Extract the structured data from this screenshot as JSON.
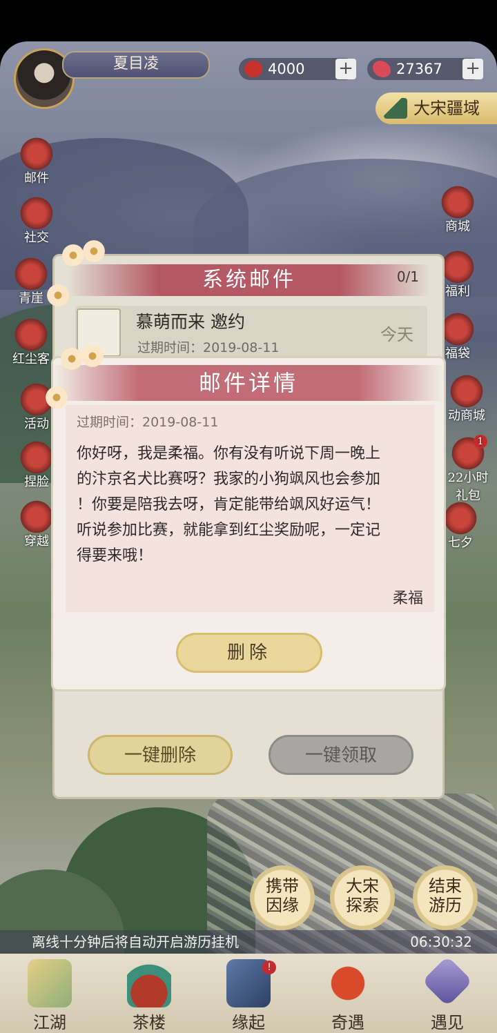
{
  "player": {
    "name": "夏目凌"
  },
  "resources": [
    {
      "icon": "red-bean-icon",
      "value": "4000",
      "plus": "+"
    },
    {
      "icon": "butterfly-icon",
      "value": "27367",
      "plus": "+"
    }
  ],
  "region": {
    "label": "大宋疆域"
  },
  "left_menu": [
    {
      "id": "mail",
      "label": "邮件"
    },
    {
      "id": "social",
      "label": "社交"
    },
    {
      "id": "qingya",
      "label": "青崖"
    },
    {
      "id": "hongchenke",
      "label": "红尘客"
    },
    {
      "id": "events",
      "label": "活动"
    },
    {
      "id": "face",
      "label": "捏脸"
    },
    {
      "id": "travel",
      "label": "穿越"
    }
  ],
  "right_menu": [
    {
      "id": "shop",
      "label": "商城"
    },
    {
      "id": "welfare",
      "label": "福利"
    },
    {
      "id": "lucky-bag",
      "label": "福袋"
    },
    {
      "id": "event-shop",
      "label": "动商城"
    },
    {
      "id": "gift-pack",
      "label": "22小时",
      "sub": "礼包",
      "badge": "1"
    },
    {
      "id": "qixi",
      "label": "七夕"
    }
  ],
  "mail_panel": {
    "title": "系统邮件",
    "count": "0/1",
    "mail": {
      "title": "慕萌而来 邀约",
      "expiry": "过期时间：2019-08-11",
      "date": "今天"
    },
    "delete_all": "一键删除",
    "claim_all": "一键领取"
  },
  "detail": {
    "title": "邮件详情",
    "expiry": "过期时间：2019-08-11",
    "lines": [
      "你好呀，我是柔福。你有没有听说下周一晚上",
      "的汴京名犬比赛呀？我家的小狗飒风也会参加",
      "！你要是陪我去呀，肯定能带给飒风好运气！",
      "听说参加比赛，就能拿到红尘奖励呢，一定记",
      "得要来哦！"
    ],
    "sender": "柔福",
    "delete": "删除"
  },
  "actions": [
    {
      "id": "carry",
      "label": "携带因缘"
    },
    {
      "id": "explore",
      "label": "大宋探索"
    },
    {
      "id": "end-travel",
      "label": "结束游历"
    }
  ],
  "offline": {
    "message": "离线十分钟后将自动开启游历挂机",
    "time": "06:30:32"
  },
  "bottom_nav": [
    {
      "id": "jianghu",
      "label": "江湖"
    },
    {
      "id": "chalou",
      "label": "茶楼"
    },
    {
      "id": "yuanqi",
      "label": "缘起"
    },
    {
      "id": "qiyu",
      "label": "奇遇"
    },
    {
      "id": "yujian",
      "label": "遇见"
    }
  ]
}
